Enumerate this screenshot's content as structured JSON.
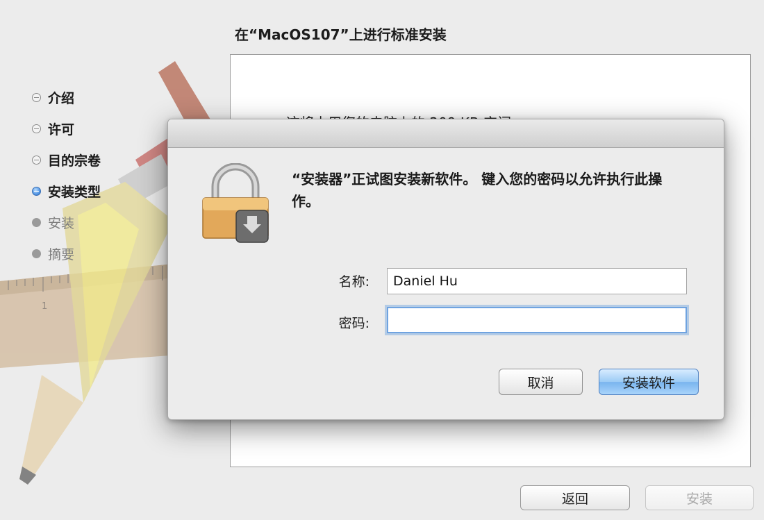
{
  "window": {
    "title": "在“MacOS107”上进行标准安装",
    "content_text": "这将占用您的电脑上的 209 KB 空间。"
  },
  "steps": [
    {
      "label": "介绍",
      "state": "done"
    },
    {
      "label": "许可",
      "state": "done"
    },
    {
      "label": "目的宗卷",
      "state": "done"
    },
    {
      "label": "安装类型",
      "state": "current"
    },
    {
      "label": "安装",
      "state": "future"
    },
    {
      "label": "摘要",
      "state": "future"
    }
  ],
  "buttons": {
    "back": "返回",
    "install": "安装"
  },
  "dialog": {
    "message": "“安装器”正试图安装新软件。 键入您的密码以允许执行此操作。",
    "name_label": "名称:",
    "name_value": "Daniel Hu",
    "password_label": "密码:",
    "password_value": "",
    "cancel_label": "取消",
    "confirm_label": "安装软件"
  },
  "colors": {
    "accent": "#4f80c0",
    "background": "#ececec"
  }
}
